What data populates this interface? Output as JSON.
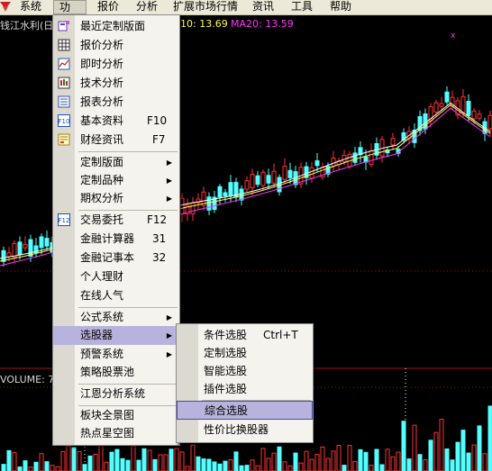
{
  "menubar": {
    "items": [
      "系统",
      "功能",
      "报价",
      "分析",
      "扩展市场行情",
      "资讯",
      "工具",
      "帮助"
    ],
    "active_index": 1
  },
  "chart": {
    "title": "钱江水利(日",
    "ma10": "10: 13.69",
    "ma20": "MA20: 13.59",
    "volume_label": "VOLUME: 7",
    "colors": {
      "up": "#ff3232",
      "down": "#54ffff",
      "ma5": "#ffffff",
      "ma10": "#ffff3c",
      "ma20": "#ff33ff",
      "grid": "#a01010"
    }
  },
  "function_menu": {
    "items": [
      {
        "label": "最近定制版面",
        "icon": "recent-layout-icon"
      },
      {
        "label": "报价分析",
        "icon": "quote-grid-icon"
      },
      {
        "label": "即时分析",
        "icon": "realtime-chart-icon"
      },
      {
        "label": "技术分析",
        "icon": "candlestick-icon"
      },
      {
        "label": "报表分析",
        "icon": "report-icon"
      },
      {
        "label": "基本资料",
        "shortcut": "F10",
        "icon": "f10-icon"
      },
      {
        "label": "财经资讯",
        "shortcut": "F7",
        "icon": "news-icon"
      },
      {
        "label": "定制版面",
        "submenu": true
      },
      {
        "label": "定制品种",
        "submenu": true
      },
      {
        "label": "期权分析",
        "submenu": true
      },
      {
        "label": "交易委托",
        "shortcut": "F12",
        "icon": "f12-icon"
      },
      {
        "label": "金融计算器",
        "shortcut": "31"
      },
      {
        "label": "金融记事本",
        "shortcut": "32"
      },
      {
        "label": "个人理财"
      },
      {
        "label": "在线人气"
      },
      {
        "label": "公式系统",
        "submenu": true
      },
      {
        "label": "选股器",
        "submenu": true
      },
      {
        "label": "预警系统",
        "submenu": true
      },
      {
        "label": "策略股票池"
      },
      {
        "label": "江恩分析系统"
      },
      {
        "label": "板块全景图"
      },
      {
        "label": "热点星空图"
      }
    ]
  },
  "stock_picker_menu": {
    "items": [
      {
        "label": "条件选股",
        "shortcut": "Ctrl+T"
      },
      {
        "label": "定制选股"
      },
      {
        "label": "智能选股"
      },
      {
        "label": "插件选股"
      },
      {
        "label": "综合选股"
      },
      {
        "label": "性价比换股器"
      }
    ]
  },
  "arrow_glyph": "▶"
}
